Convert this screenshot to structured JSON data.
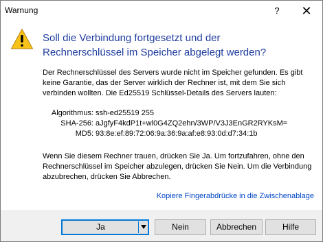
{
  "window": {
    "title": "Warnung",
    "help_glyph": "?",
    "close_glyph": "✕"
  },
  "icon": "warning-icon",
  "heading": "Soll die Verbindung fortgesetzt und der Rechnerschlüssel im Speicher abgelegt werden?",
  "paragraph1": "Der Rechnerschlüssel des Servers wurde nicht im Speicher gefunden. Es gibt keine Garantie, das der Server wirklich der Rechner ist, mit dem Sie sich verbinden wollten. Die Ed25519 Schlüssel-Details des Servers lauten:",
  "details": {
    "algorithm_label": "Algorithmus:",
    "algorithm_value": "ssh-ed25519 255",
    "sha256_label": "SHA-256:",
    "sha256_value": "aJgfyF4kdP1t+wl0G4ZQ2ehn/3WP/V3J3EnGR2RYKsM=",
    "md5_label": "MD5:",
    "md5_value": "93:8e:ef:89:72:06:9a:36:9a:af:e8:93:0d:d7:34:1b"
  },
  "paragraph2": "Wenn Sie diesem Rechner trauen, drücken Sie Ja. Um fortzufahren, ohne den Rechnerschlüssel im Speicher abzulegen, drücken Sie Nein. Um die Verbindung abzubrechen, drücken Sie Abbrechen.",
  "link": "Kopiere Fingerabdrücke in die Zwischenablage",
  "buttons": {
    "ja": "Ja",
    "nein": "Nein",
    "abbrechen": "Abbrechen",
    "hilfe": "Hilfe"
  },
  "colors": {
    "heading": "#1e3c9e",
    "link": "#0046c7",
    "default_button_border": "#0078d7",
    "warning_fill": "#f7c21a"
  }
}
